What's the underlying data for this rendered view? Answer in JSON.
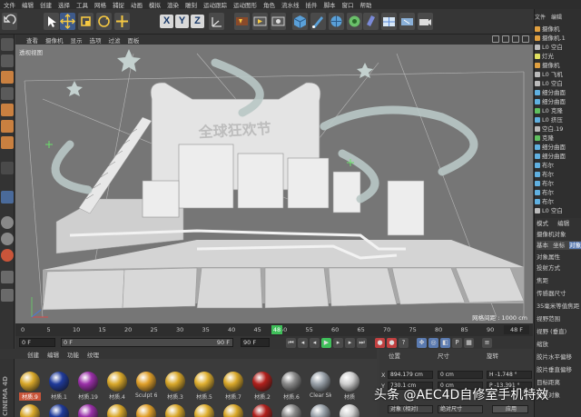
{
  "menubar": [
    "文件",
    "编辑",
    "创建",
    "选择",
    "工具",
    "网格",
    "捕捉",
    "动画",
    "模拟",
    "渲染",
    "雕刻",
    "运动跟踪",
    "运动图形",
    "角色",
    "流水线",
    "插件",
    "脚本",
    "窗口",
    "帮助"
  ],
  "toolbar": {
    "x_axis": "X",
    "y_axis": "Y",
    "z_axis": "Z",
    "icons": [
      "undo-icon",
      "select-icon",
      "move-icon",
      "scale-icon",
      "rotate-icon",
      "add-icon",
      "x-axis-icon",
      "y-axis-icon",
      "z-axis-icon",
      "coordinate-icon",
      "render-region-icon",
      "render-view-icon",
      "render-settings-icon",
      "cube-icon",
      "pen-icon",
      "subdivision-icon",
      "array-icon",
      "cloner-icon",
      "deformer-icon",
      "floor-icon",
      "camera-icon",
      "light-icon"
    ]
  },
  "viewport": {
    "menu": [
      "查看",
      "摄像机",
      "显示",
      "选项",
      "过滤",
      "面板"
    ],
    "label": "透视视图",
    "grid_spacing": "网格间距 : 1000 cm",
    "sign_text": "全球狂欢节",
    "colors": {
      "background": "#767676",
      "stage": "#d8d8d8",
      "shadow": "#9a9a9a"
    }
  },
  "timeline": {
    "ticks": [
      "0",
      "5",
      "10",
      "15",
      "20",
      "25",
      "30",
      "35",
      "40",
      "45",
      "50",
      "55",
      "60",
      "65",
      "70",
      "75",
      "80",
      "85",
      "90"
    ],
    "current_frame": "48",
    "current_frame_right": "48 F",
    "start_field": "0 F",
    "range_start": "0 F",
    "range_end": "90 F",
    "end_field": "90 F"
  },
  "materials": {
    "menu": [
      "创建",
      "编辑",
      "功能",
      "纹理"
    ],
    "row1": [
      {
        "name": "材质.9",
        "color": "#d9a82a",
        "selected": true
      },
      {
        "name": "材质.1",
        "color": "#1f3a9a",
        "selected": false
      },
      {
        "name": "材质.19",
        "color": "#9a2fa8",
        "selected": false
      },
      {
        "name": "材质.4",
        "color": "#d9a82a",
        "selected": false
      },
      {
        "name": "Sculpt 6",
        "color": "#e0a02a",
        "selected": false
      },
      {
        "name": "材质.3",
        "color": "#d9a82a",
        "selected": false
      },
      {
        "name": "材质.5",
        "color": "#e0b030",
        "selected": false
      },
      {
        "name": "材质.7",
        "color": "#d9a82a",
        "selected": false
      },
      {
        "name": "材质.2",
        "color": "#b0201c",
        "selected": false
      },
      {
        "name": "材质.6",
        "color": "#8a8a8a",
        "selected": false
      },
      {
        "name": "Clear Sk",
        "color": "#9aa2aa",
        "selected": false
      },
      {
        "name": "材质",
        "color": "#cfcfcf",
        "selected": false
      }
    ],
    "row2_colors": [
      "#d9a82a",
      "#1f3a9a",
      "#9a2fa8",
      "#d9a82a",
      "#e0a02a",
      "#d9a82a",
      "#e0b030",
      "#d9a82a",
      "#b0201c",
      "#8a8a8a",
      "#9aa2aa",
      "#cfcfcf"
    ]
  },
  "coordinates": {
    "headers": [
      "位置",
      "尺寸",
      "旋转"
    ],
    "x_label": "X",
    "x_pos": "894.179 cm",
    "x_size": "0 cm",
    "x_rot": "H  -1.748 °",
    "y_label": "Y",
    "y_pos": "730.1 cm",
    "y_size": "0 cm",
    "y_rot": "P  -13.391 °",
    "mode_left": "对象 (相对)",
    "mode_mid": "绝对尺寸",
    "apply": "应用"
  },
  "object_manager": {
    "tabs": [
      "文件",
      "编辑"
    ],
    "rows": [
      {
        "label": "摄像机",
        "icon_color": "#e0a040",
        "name": "object-camera"
      },
      {
        "label": "摄像机.1",
        "icon_color": "#e0a040",
        "name": "object-camera-1"
      },
      {
        "label": "L0 空白",
        "icon_color": "#bbbbbb",
        "name": "object-null"
      },
      {
        "label": "灯光",
        "icon_color": "#e0e060",
        "name": "object-light"
      },
      {
        "label": "摄像机",
        "icon_color": "#e0a040",
        "name": "object-camera-2"
      },
      {
        "label": "L0 飞机",
        "icon_color": "#bbbbbb",
        "name": "object-plane"
      },
      {
        "label": "L0 空白",
        "icon_color": "#bbbbbb",
        "name": "object-null-2"
      },
      {
        "label": "细分曲面",
        "icon_color": "#60b0e0",
        "name": "object-subdiv"
      },
      {
        "label": "细分曲面",
        "icon_color": "#60b0e0",
        "name": "object-subdiv-2"
      },
      {
        "label": "L0 克隆",
        "icon_color": "#60c060",
        "name": "object-cloner"
      },
      {
        "label": "L0 挤压",
        "icon_color": "#60b0e0",
        "name": "object-extrude"
      },
      {
        "label": "空白.19",
        "icon_color": "#bbbbbb",
        "name": "object-null-19"
      },
      {
        "label": "克隆",
        "icon_color": "#60c060",
        "name": "object-cloner-2"
      },
      {
        "label": "细分曲面",
        "icon_color": "#60b0e0",
        "name": "object-subdiv-3"
      },
      {
        "label": "细分曲面",
        "icon_color": "#60b0e0",
        "name": "object-subdiv-4"
      },
      {
        "label": "布尔",
        "icon_color": "#60b0e0",
        "name": "object-boolean"
      },
      {
        "label": "布尔",
        "icon_color": "#60b0e0",
        "name": "object-boolean-2"
      },
      {
        "label": "布尔",
        "icon_color": "#60b0e0",
        "name": "object-boolean-3"
      },
      {
        "label": "布尔",
        "icon_color": "#60b0e0",
        "name": "object-boolean-4"
      },
      {
        "label": "布尔",
        "icon_color": "#60b0e0",
        "name": "object-boolean-5"
      },
      {
        "label": "L0 空白",
        "icon_color": "#bbbbbb",
        "name": "object-null-3"
      }
    ]
  },
  "attributes": {
    "tabs": [
      "模式",
      "编辑"
    ],
    "title": "摄像机对象",
    "subtabs": [
      "基本",
      "坐标",
      "对象"
    ],
    "section": "对象属性",
    "rows": [
      "投射方式",
      "焦距",
      "传感器尺寸",
      "35毫米等值焦距",
      "视野范围",
      "视野 (垂直)",
      "缩放",
      "胶片水平偏移",
      "胶片垂直偏移",
      "目标距离",
      "焦点对象"
    ]
  },
  "branding": {
    "vertical": "CINEMA 4D",
    "watermark": "头条 @AEC4D自修室手机特效"
  }
}
